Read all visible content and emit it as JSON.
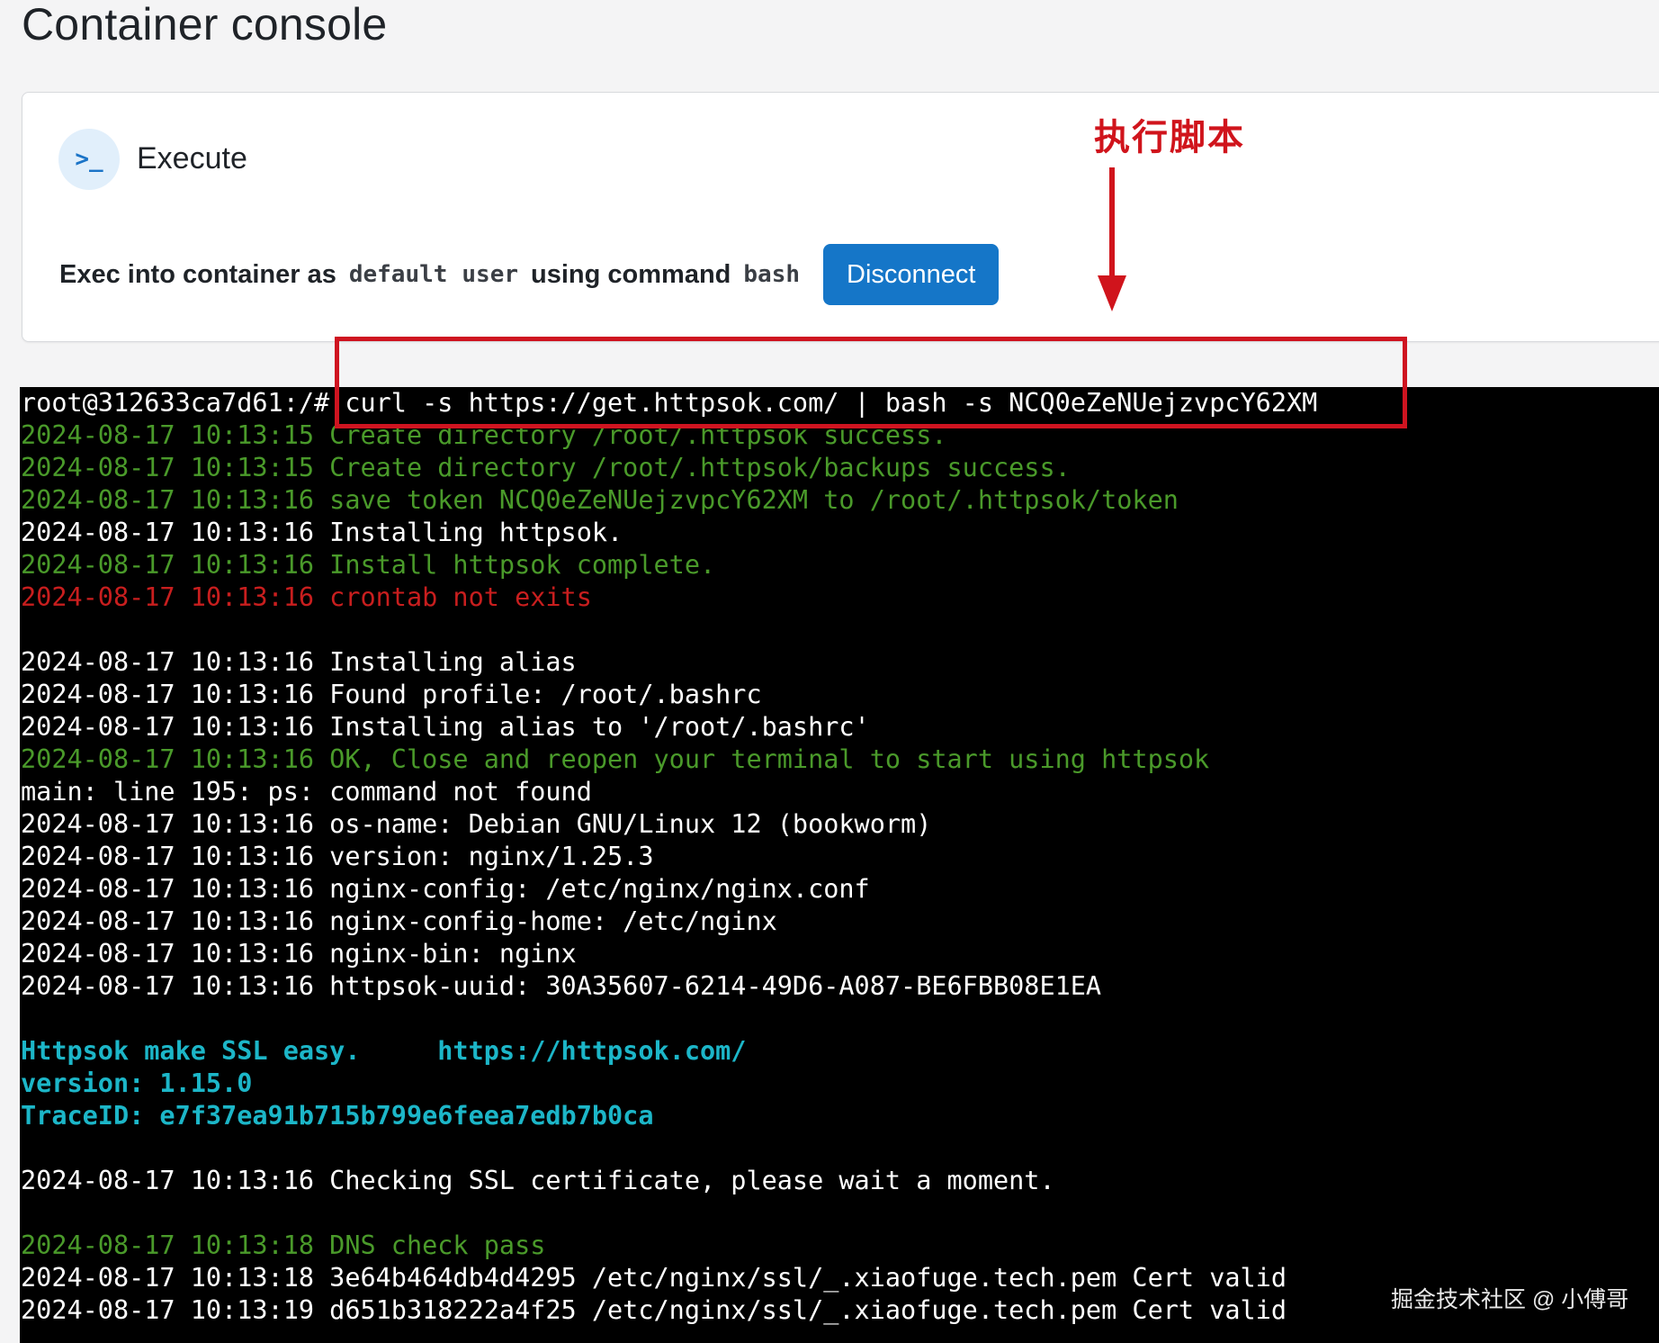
{
  "page": {
    "title": "Container console"
  },
  "exec_card": {
    "icon": "terminal-prompt-icon",
    "icon_glyph": ">_",
    "title": "Execute",
    "label_prefix": "Exec into container as",
    "user_value": "default",
    "user_word": "user",
    "label_command": "using command",
    "command_value": "bash",
    "disconnect_label": "Disconnect"
  },
  "annotation": {
    "text": "执行脚本",
    "color": "#d0141c"
  },
  "terminal": {
    "lines": [
      {
        "text": "root@312633ca7d61:/# curl -s https://get.httpsok.com/ | bash -s NCQ0eZeNUejzvpcY62XM",
        "color": "white"
      },
      {
        "text": "2024-08-17 10:13:15 Create directory /root/.httpsok success.",
        "color": "green"
      },
      {
        "text": "2024-08-17 10:13:15 Create directory /root/.httpsok/backups success.",
        "color": "green"
      },
      {
        "text": "2024-08-17 10:13:16 save token NCQ0eZeNUejzvpcY62XM to /root/.httpsok/token",
        "color": "green"
      },
      {
        "text": "2024-08-17 10:13:16 Installing httpsok.",
        "color": "white"
      },
      {
        "text": "2024-08-17 10:13:16 Install httpsok complete.",
        "color": "green"
      },
      {
        "text": "2024-08-17 10:13:16 crontab not exits",
        "color": "red"
      },
      {
        "text": "",
        "color": "white"
      },
      {
        "text": "2024-08-17 10:13:16 Installing alias",
        "color": "white"
      },
      {
        "text": "2024-08-17 10:13:16 Found profile: /root/.bashrc",
        "color": "white"
      },
      {
        "text": "2024-08-17 10:13:16 Installing alias to '/root/.bashrc'",
        "color": "white"
      },
      {
        "text": "2024-08-17 10:13:16 OK, Close and reopen your terminal to start using httpsok",
        "color": "green"
      },
      {
        "text": "main: line 195: ps: command not found",
        "color": "white"
      },
      {
        "text": "2024-08-17 10:13:16 os-name: Debian GNU/Linux 12 (bookworm)",
        "color": "white"
      },
      {
        "text": "2024-08-17 10:13:16 version: nginx/1.25.3",
        "color": "white"
      },
      {
        "text": "2024-08-17 10:13:16 nginx-config: /etc/nginx/nginx.conf",
        "color": "white"
      },
      {
        "text": "2024-08-17 10:13:16 nginx-config-home: /etc/nginx",
        "color": "white"
      },
      {
        "text": "2024-08-17 10:13:16 nginx-bin: nginx",
        "color": "white"
      },
      {
        "text": "2024-08-17 10:13:16 httpsok-uuid: 30A35607-6214-49D6-A087-BE6FBB08E1EA",
        "color": "white"
      },
      {
        "text": "",
        "color": "white"
      },
      {
        "text": "Httpsok make SSL easy.     https://httpsok.com/",
        "color": "cyan"
      },
      {
        "text": "version: 1.15.0",
        "color": "cyan"
      },
      {
        "text": "TraceID: e7f37ea91b715b799e6feea7edb7b0ca",
        "color": "cyan"
      },
      {
        "text": "",
        "color": "white"
      },
      {
        "text": "2024-08-17 10:13:16 Checking SSL certificate, please wait a moment.",
        "color": "white"
      },
      {
        "text": "",
        "color": "white"
      },
      {
        "text": "2024-08-17 10:13:18 DNS check pass",
        "color": "green"
      },
      {
        "text": "2024-08-17 10:13:18 3e64b464db4d4295 /etc/nginx/ssl/_.xiaofuge.tech.pem Cert valid",
        "color": "white"
      },
      {
        "text": "2024-08-17 10:13:19 d651b318222a4f25 /etc/nginx/ssl/_.xiaofuge.tech.pem Cert valid",
        "color": "white"
      }
    ]
  },
  "watermark": {
    "text": "掘金技术社区 @ 小傅哥"
  }
}
